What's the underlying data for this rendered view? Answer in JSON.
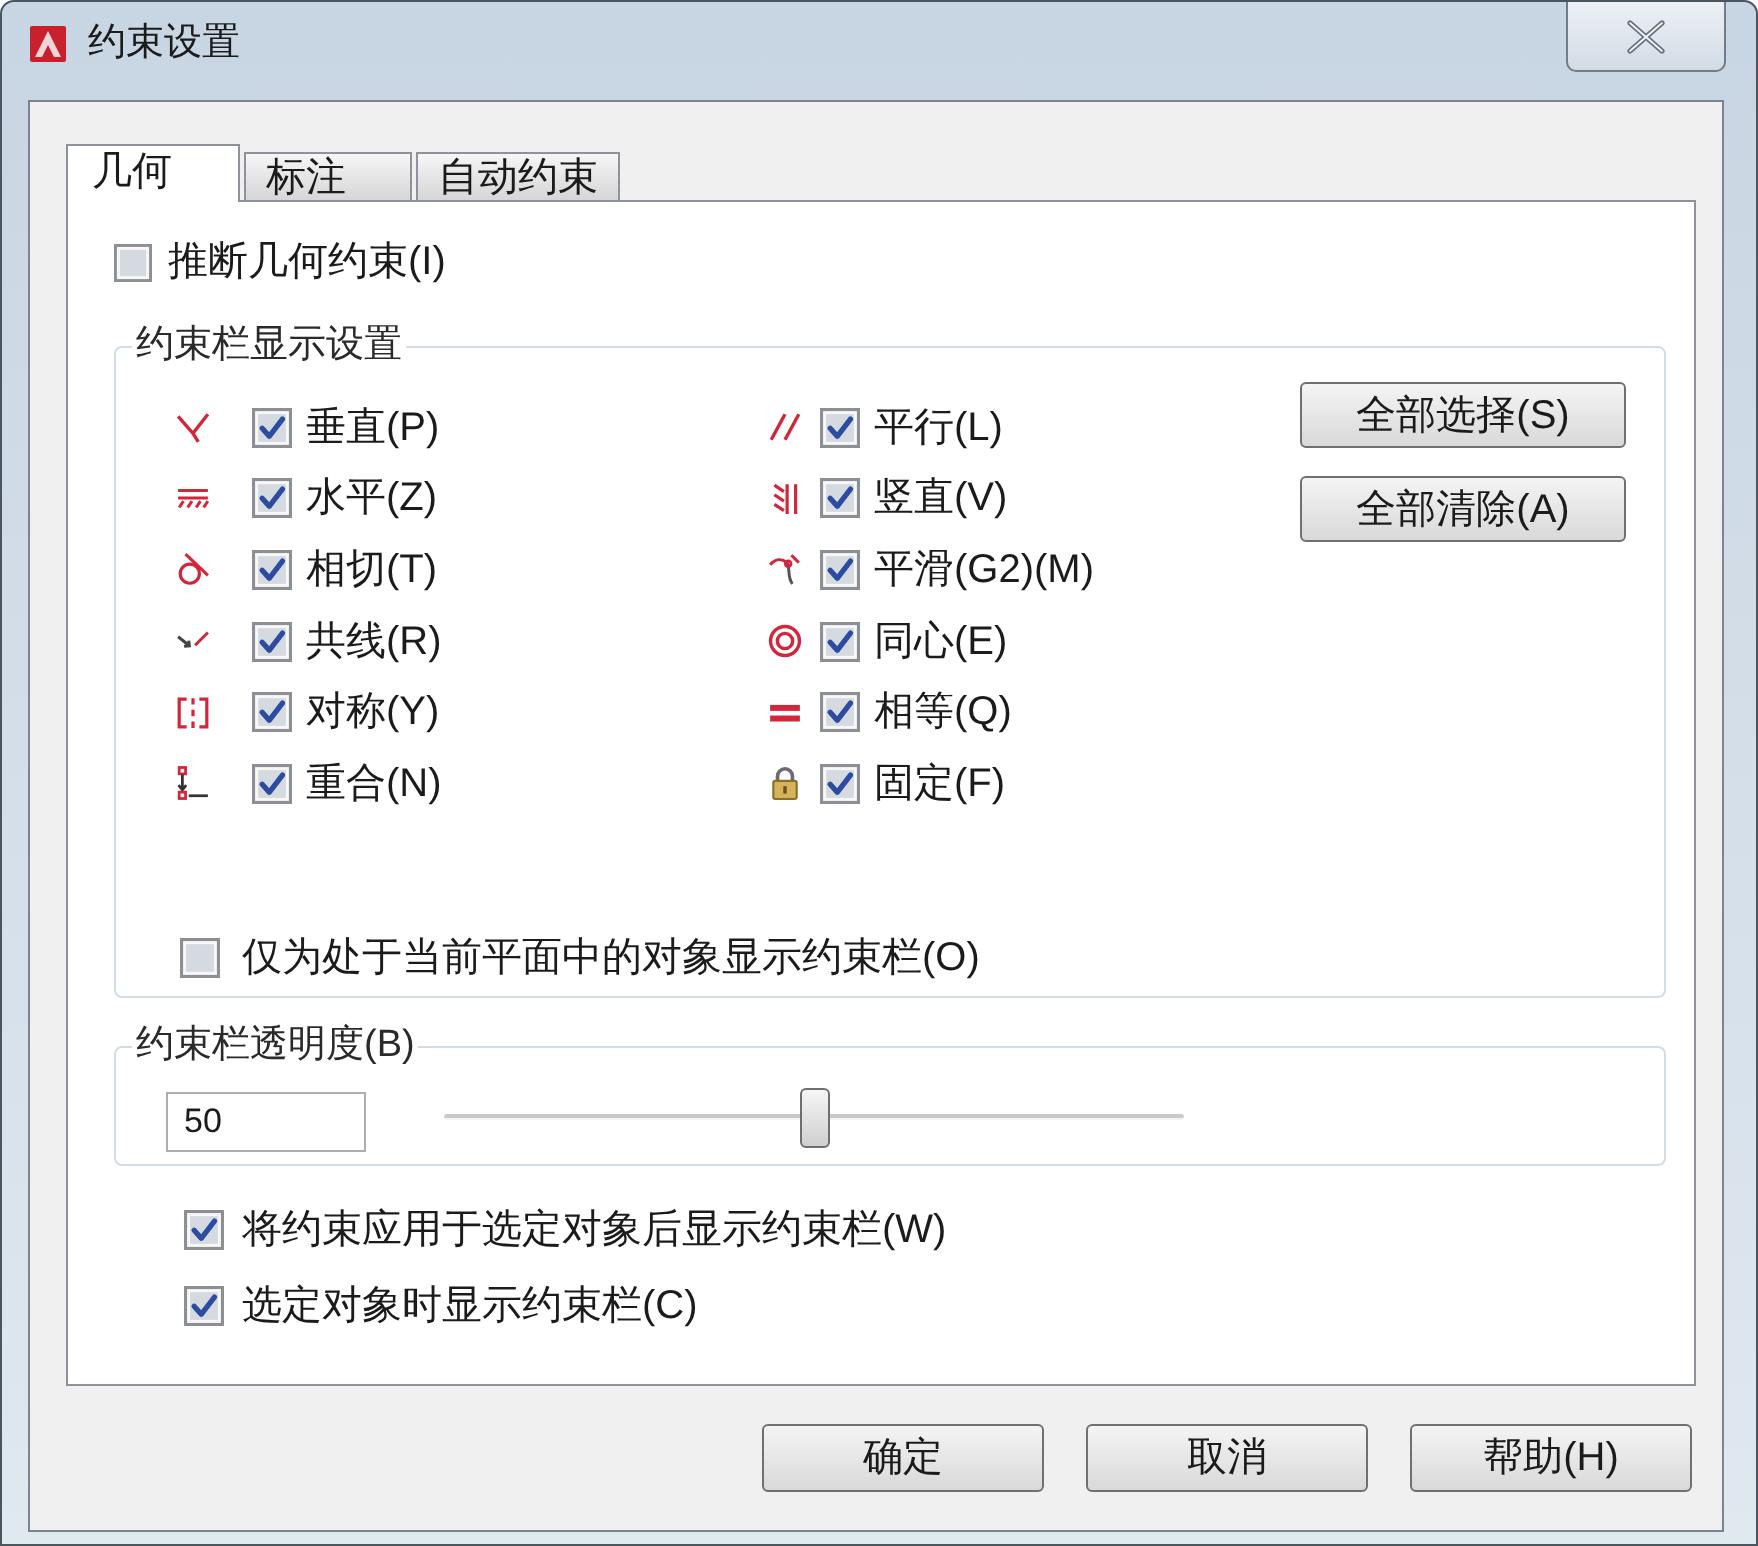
{
  "window": {
    "title": "约束设置"
  },
  "tabs": [
    {
      "label": "几何",
      "selected": true
    },
    {
      "label": "标注",
      "selected": false
    },
    {
      "label": "自动约束",
      "selected": false
    }
  ],
  "infer_constraints": {
    "label": "推断几何约束(I)",
    "checked": false
  },
  "constraint_bar_display": {
    "title": "约束栏显示设置",
    "constraints": [
      {
        "kind": "perpendicular",
        "label": "垂直(P)",
        "checked": true
      },
      {
        "kind": "parallel",
        "label": "平行(L)",
        "checked": true
      },
      {
        "kind": "horizontal",
        "label": "水平(Z)",
        "checked": true
      },
      {
        "kind": "vertical",
        "label": "竖直(V)",
        "checked": true
      },
      {
        "kind": "tangent",
        "label": "相切(T)",
        "checked": true
      },
      {
        "kind": "smooth",
        "label": "平滑(G2)(M)",
        "checked": true
      },
      {
        "kind": "collinear",
        "label": "共线(R)",
        "checked": true
      },
      {
        "kind": "concentric",
        "label": "同心(E)",
        "checked": true
      },
      {
        "kind": "symmetric",
        "label": "对称(Y)",
        "checked": true
      },
      {
        "kind": "equal",
        "label": "相等(Q)",
        "checked": true
      },
      {
        "kind": "coincident",
        "label": "重合(N)",
        "checked": true
      },
      {
        "kind": "fix",
        "label": "固定(F)",
        "checked": true
      }
    ],
    "buttons": [
      "全部选择(S)",
      "全部清除(A)"
    ],
    "current_plane_only": {
      "label": "仅为处于当前平面中的对象显示约束栏(O)",
      "checked": false
    }
  },
  "transparency": {
    "title": "约束栏透明度(B)",
    "value": "50",
    "level": 0.5
  },
  "options": [
    {
      "label": "将约束应用于选定对象后显示约束栏(W)",
      "checked": true
    },
    {
      "label": "选定对象时显示约束栏(C)",
      "checked": true
    }
  ],
  "buttons": [
    "确定",
    "取消",
    "帮助(H)"
  ]
}
